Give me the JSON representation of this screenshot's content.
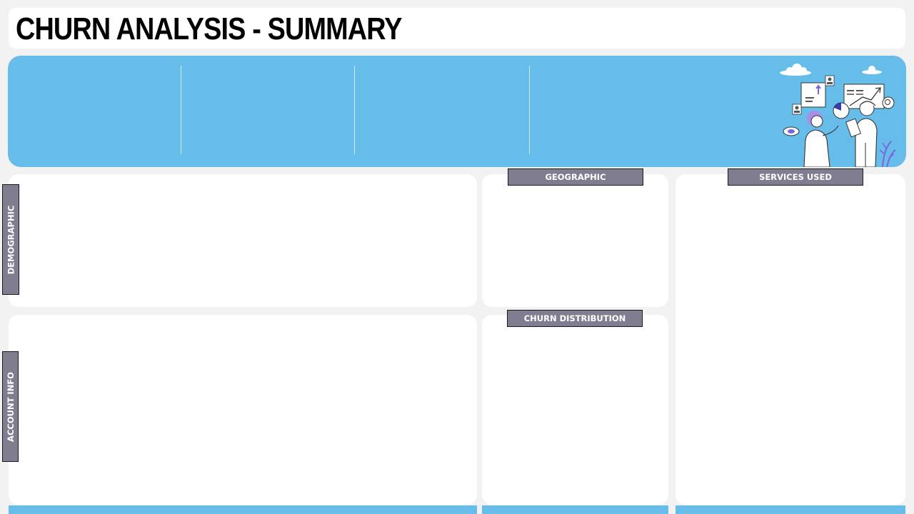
{
  "header": {
    "title": "CHURN ANALYSIS - SUMMARY"
  },
  "sections": {
    "demographic": "DEMOGRAPHIC",
    "account_info": "ACCOUNT INFO",
    "geographic": "GEOGRAPHIC",
    "churn_distribution": "CHURN DISTRIBUTION",
    "services_used": "SERVICES USED"
  },
  "colors": {
    "page_background": "#f2f2f2",
    "kpi_band": "#66bde9",
    "section_tag": "#7f7d8f",
    "card": "#ffffff"
  },
  "illustration": {
    "icon": "data-analysts-illustration"
  }
}
